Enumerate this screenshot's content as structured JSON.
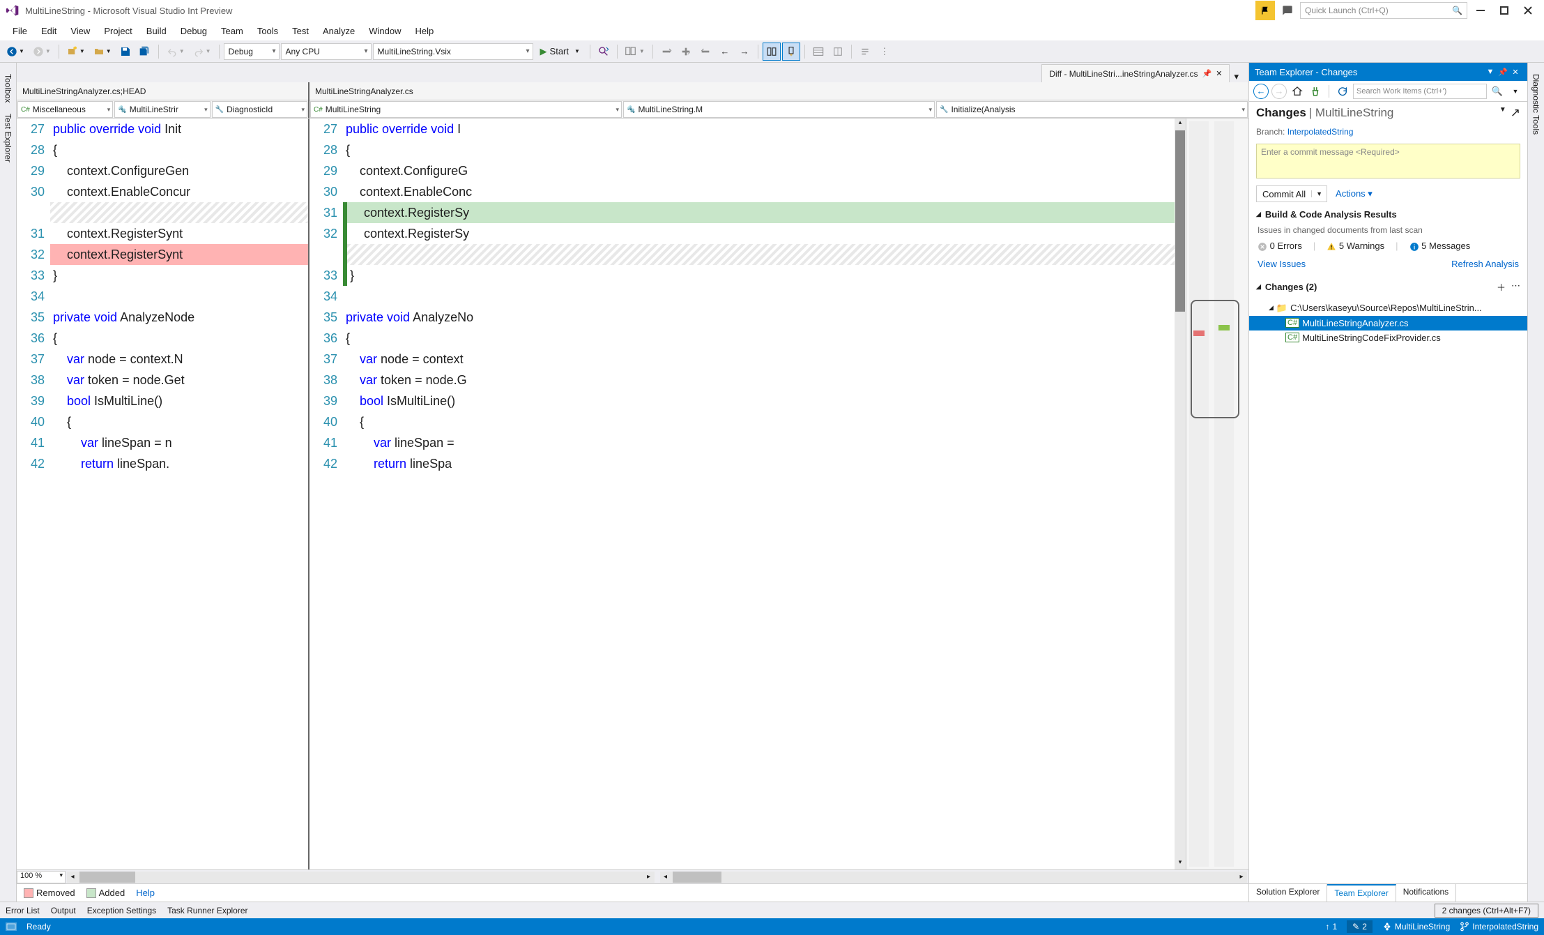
{
  "title": "MultiLineString - Microsoft Visual Studio Int Preview",
  "quick_launch_placeholder": "Quick Launch (Ctrl+Q)",
  "menu": [
    "File",
    "Edit",
    "View",
    "Project",
    "Build",
    "Debug",
    "Team",
    "Tools",
    "Test",
    "Analyze",
    "Window",
    "Help"
  ],
  "toolbar": {
    "config": "Debug",
    "platform": "Any CPU",
    "startup": "MultiLineString.Vsix",
    "start_label": "Start"
  },
  "left_tabs": [
    "Toolbox",
    "Test Explorer"
  ],
  "right_tabs": [
    "Diagnostic Tools"
  ],
  "doc_tab": "Diff - MultiLineStri...ineStringAnalyzer.cs",
  "diff": {
    "left_header": "MultiLineStringAnalyzer.cs;HEAD",
    "right_header": "MultiLineStringAnalyzer.cs",
    "left_nav": [
      "Miscellaneous",
      "MultiLineStrir",
      "DiagnosticId"
    ],
    "right_nav": [
      "MultiLineString",
      "MultiLineString.M",
      "Initialize(Analysis"
    ],
    "zoom": "100 %",
    "legend_removed": "Removed",
    "legend_added": "Added",
    "legend_help": "Help",
    "left_lines": [
      {
        "no": "27",
        "html": "<span class='kw'>public</span> <span class='kw'>override</span> <span class='kw'>void</span> Init"
      },
      {
        "no": "28",
        "html": "{"
      },
      {
        "no": "29",
        "html": "    context.ConfigureGen"
      },
      {
        "no": "30",
        "html": "    context.EnableConcur"
      },
      {
        "no": "",
        "html": "",
        "hatched": true
      },
      {
        "no": "31",
        "html": "    context.RegisterSynt"
      },
      {
        "no": "32",
        "html": "    context.RegisterSynt",
        "removed": true
      },
      {
        "no": "33",
        "html": "}"
      },
      {
        "no": "34",
        "html": ""
      },
      {
        "no": "35",
        "html": "<span class='kw'>private</span> <span class='kw'>void</span> AnalyzeNode"
      },
      {
        "no": "36",
        "html": "{"
      },
      {
        "no": "37",
        "html": "    <span class='kw'>var</span> node = context.N"
      },
      {
        "no": "38",
        "html": "    <span class='kw'>var</span> token = node.Get"
      },
      {
        "no": "39",
        "html": "    <span class='kw'>bool</span> IsMultiLine()"
      },
      {
        "no": "40",
        "html": "    {"
      },
      {
        "no": "41",
        "html": "        <span class='kw'>var</span> lineSpan = n"
      },
      {
        "no": "42",
        "html": "        <span class='kw'>return</span> lineSpan."
      }
    ],
    "right_lines": [
      {
        "no": "27",
        "html": "<span class='kw'>public</span> <span class='kw'>override</span> <span class='kw'>void</span> I"
      },
      {
        "no": "28",
        "html": "{"
      },
      {
        "no": "29",
        "html": "    context.ConfigureG"
      },
      {
        "no": "30",
        "html": "    context.EnableConc"
      },
      {
        "no": "31",
        "html": "    context.RegisterSy",
        "added": true,
        "greenbar": true
      },
      {
        "no": "32",
        "html": "    context.RegisterSy",
        "greenbar": true
      },
      {
        "no": "",
        "html": "",
        "hatched": true,
        "greenbar": true
      },
      {
        "no": "33",
        "html": "}",
        "greenbar": true
      },
      {
        "no": "34",
        "html": ""
      },
      {
        "no": "35",
        "html": "<span class='kw'>private</span> <span class='kw'>void</span> AnalyzeNo"
      },
      {
        "no": "36",
        "html": "{"
      },
      {
        "no": "37",
        "html": "    <span class='kw'>var</span> node = context"
      },
      {
        "no": "38",
        "html": "    <span class='kw'>var</span> token = node.G"
      },
      {
        "no": "39",
        "html": "    <span class='kw'>bool</span> IsMultiLine()"
      },
      {
        "no": "40",
        "html": "    {"
      },
      {
        "no": "41",
        "html": "        <span class='kw'>var</span> lineSpan ="
      },
      {
        "no": "42",
        "html": "        <span class='kw'>return</span> lineSpa"
      }
    ]
  },
  "team_explorer": {
    "title": "Team Explorer - Changes",
    "search_placeholder": "Search Work Items (Ctrl+')",
    "heading_main": "Changes",
    "heading_sub": "| MultiLineString",
    "branch_label": "Branch:",
    "branch_name": "InterpolatedString",
    "commit_placeholder": "Enter a commit message <Required>",
    "commit_button": "Commit All",
    "actions_label": "Actions",
    "build_section": "Build & Code Analysis Results",
    "issues_text": "Issues in changed documents from last scan",
    "errors": "0 Errors",
    "warnings": "5 Warnings",
    "messages": "5 Messages",
    "view_issues": "View Issues",
    "refresh": "Refresh Analysis",
    "changes_section": "Changes (2)",
    "tree_root": "C:\\Users\\kaseyu\\Source\\Repos\\MultiLineStrin...",
    "tree_file1": "MultiLineStringAnalyzer.cs",
    "tree_file2": "MultiLineStringCodeFixProvider.cs",
    "tabs": [
      "Solution Explorer",
      "Team Explorer",
      "Notifications"
    ]
  },
  "bottom_tabs": [
    "Error List",
    "Output",
    "Exception Settings",
    "Task Runner Explorer"
  ],
  "changes_indicator": "2 changes (Ctrl+Alt+F7)",
  "status": {
    "ready": "Ready",
    "up_count": "1",
    "pencil_count": "2",
    "project": "MultiLineString",
    "branch": "InterpolatedString"
  }
}
